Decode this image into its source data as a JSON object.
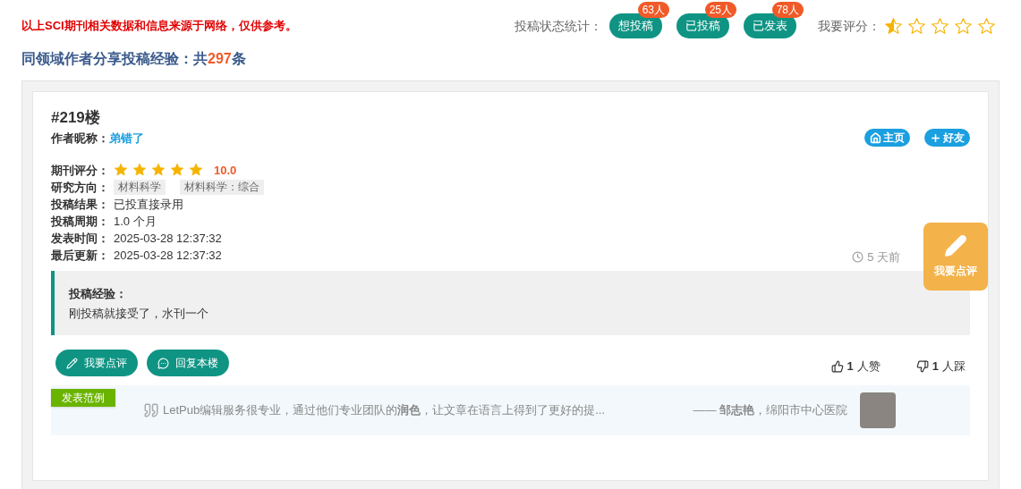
{
  "notice": "以上SCI期刊相关数据和信息来源于网络，仅供参考。",
  "status_stats": {
    "label": "投稿状态统计：",
    "items": [
      {
        "label": "想投稿",
        "count": "63人"
      },
      {
        "label": "已投稿",
        "count": "25人"
      },
      {
        "label": "已发表",
        "count": "78人"
      }
    ]
  },
  "my_rating": {
    "label": "我要评分：",
    "stars": 0.5
  },
  "heading": {
    "text": "同领域作者分享投稿经验：共",
    "count": "297",
    "suffix": "条"
  },
  "post": {
    "floor": "#219楼",
    "author_label": "作者昵称：",
    "author": "弟错了",
    "actions": [
      {
        "kind": "home",
        "label": "主页"
      },
      {
        "kind": "friend",
        "label": "好友"
      }
    ],
    "journal_rating": {
      "label": "期刊评分：",
      "stars": 5,
      "score": "10.0"
    },
    "research": {
      "label": "研究方向：",
      "tags": [
        "材料科学",
        "材料科学：综合"
      ]
    },
    "fields": [
      {
        "label": "投稿结果：",
        "value": "已投直接录用"
      },
      {
        "label": "投稿周期：",
        "value": "1.0 个月"
      },
      {
        "label": "发表时间：",
        "value": "2025-03-28 12:37:32"
      },
      {
        "label": "最后更新：",
        "value": "2025-03-28 12:37:32"
      }
    ],
    "time_ago": "5 天前",
    "experience": {
      "title": "投稿经验：",
      "text": "刚投稿就接受了，水刊一个"
    },
    "buttons": [
      {
        "kind": "comment",
        "label": "我要点评"
      },
      {
        "kind": "reply",
        "label": "回复本楼"
      }
    ],
    "likes": {
      "count": "1",
      "label": "人赞"
    },
    "dislikes": {
      "count": "1",
      "label": "人踩"
    }
  },
  "showcase": {
    "badge": "发表范例",
    "quote": "LetPub编辑服务很专业，通过他们专业团队的**润色**，让文章在语言上得到了更好的提...",
    "attribution": "—— **邹志艳**，绵阳市中心医院"
  },
  "float_button": {
    "label": "我要点评"
  }
}
